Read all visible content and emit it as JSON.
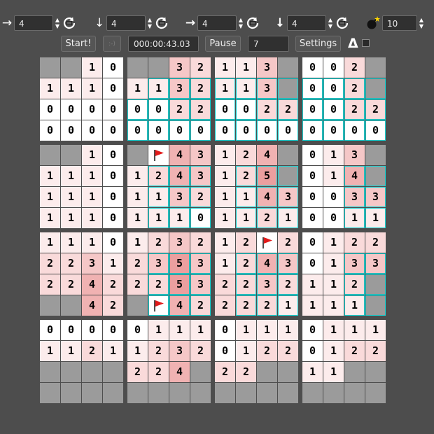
{
  "toolbar": {
    "dims": [
      {
        "arrow": "→",
        "value": "4",
        "arrow_name": "right-arrow-icon"
      },
      {
        "arrow": "↓",
        "value": "4",
        "arrow_name": "down-arrow-icon"
      },
      {
        "arrow": "→",
        "value": "4",
        "arrow_name": "bold-right-arrow-icon"
      },
      {
        "arrow": "↓",
        "value": "4",
        "arrow_name": "bold-down-arrow-icon"
      }
    ],
    "mines": "10",
    "start_label": "Start!",
    "smiley_label": ":-)",
    "timer": "000:00:43.03",
    "pause_label": "Pause",
    "count": "7",
    "settings_label": "Settings",
    "delta_symbol": "Δ"
  },
  "board": {
    "grid": [
      "##10 ##32 113# 002#",
      "1110 1132 113# 002#",
      "0000 0022 0022 0022",
      "0000 0000 0000 0000",
      "##10 #F43 124# 013#",
      "1110 1243 125# 014#",
      "1110 1132 1143 0033",
      "1110 1110 1121 0011",
      "1110 1232 12F2 0122",
      "2231 2353 1243 0133",
      "2242 2253 2232 112#",
      "##42 #F42 2221 111#",
      "0000 0111 0111 0111",
      "1121 1232 0122 0122",
      "#### 224# 22## 11##",
      "#### #### #### ####"
    ],
    "highlight": [
      "..........................",
      ".....xxxx.xxxx.xxxx",
      ".....xxxx.xxxx.xxxx",
      ".....xxxx.xxxx.xxxx",
      "..........................",
      ".....xxxx.xxxx.xxxx",
      ".....xxxx.xxxx.xxxx",
      ".....xxxx.xxxx.xxxx",
      "..........................",
      ".....xxxx.xxxx.xxxx",
      ".....xxxx.xxxx.xxxx",
      ".....xxxx.xxxx.xxxx",
      "..........................",
      "..........................",
      "..........................",
      ".........................."
    ],
    "colors": {
      "c0": "#ffffff",
      "c1": "#fcecec",
      "c2": "#f9dada",
      "c3": "#f5c7c7",
      "c4": "#f0b2b2",
      "c5": "#eb9f9f",
      "unrevealed": "#9b9b9b",
      "flag": "#e21b1b",
      "highlight": "#19d3d3"
    }
  }
}
